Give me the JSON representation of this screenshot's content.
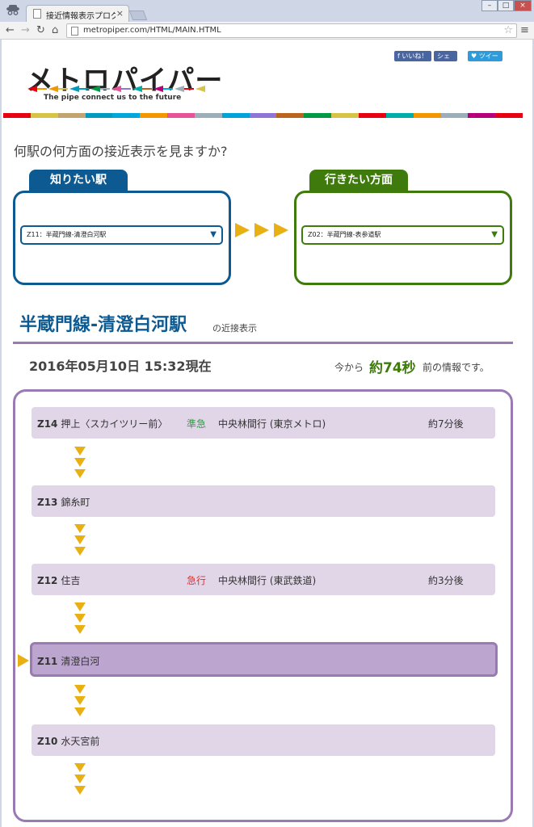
{
  "browser": {
    "tab_title": "接近情報表示プログラム「メ",
    "tab_close": "×",
    "url": "metropiper.com/HTML/MAIN.HTML",
    "window_controls": [
      "–",
      "□",
      "×"
    ]
  },
  "header": {
    "logo_title": "メトロパイパー",
    "tagline": "The pipe connect us to the future",
    "social": {
      "like": "いいね！",
      "share": "シェア",
      "tweet": "ツイート"
    },
    "stripe_colors": [
      "#e60012",
      "#d7c447",
      "#c1a470",
      "#009bbf",
      "#00a7db",
      "#f39700",
      "#e85298",
      "#9caeb7",
      "#00a3d9",
      "#8f76d6",
      "#bb641d",
      "#009944",
      "#d7c447",
      "#e60012",
      "#00ada9",
      "#f39700",
      "#9caeb7",
      "#b6007a",
      "#e60012"
    ]
  },
  "selector": {
    "question": "何駅の何方面の接近表示を見ますか?",
    "from_label": "知りたい駅",
    "from_value": "Z11：半蔵門線-清澄白河駅",
    "to_label": "行きたい方面",
    "to_value": "Z02：半蔵門線-表参道駅"
  },
  "info": {
    "station": "半蔵門線-清澄白河駅",
    "station_suffix": "の近接表示",
    "timestamp": "2016年05月10日 15:32現在",
    "ago_prefix": "今から",
    "ago_value": "約74秒",
    "ago_suffix": "前の情報です。"
  },
  "board": {
    "rows": [
      {
        "code": "Z14",
        "name": "押上〈スカイツリー前〉",
        "train_type": "準急",
        "type_color": "#2f9e44",
        "dest": "中央林間行 (東京メトロ)",
        "eta": "約7分後"
      },
      {
        "code": "Z13",
        "name": "錦糸町",
        "train_type": "",
        "type_color": "#333333",
        "dest": "",
        "eta": ""
      },
      {
        "code": "Z12",
        "name": "住吉",
        "train_type": "急行",
        "type_color": "#e03131",
        "dest": "中央林間行 (東武鉄道)",
        "eta": "約3分後"
      },
      {
        "code": "Z11",
        "name": "清澄白河",
        "train_type": "",
        "type_color": "#333333",
        "dest": "",
        "eta": ""
      },
      {
        "code": "Z10",
        "name": "水天宮前",
        "train_type": "",
        "type_color": "#333333",
        "dest": "",
        "eta": ""
      }
    ]
  }
}
